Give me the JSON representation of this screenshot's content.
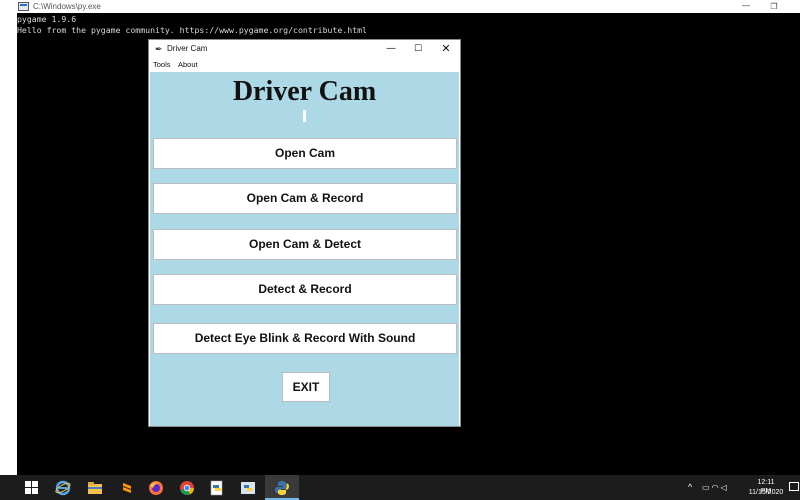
{
  "console": {
    "title": "C:\\Windows\\py.exe",
    "lines": [
      "pygame 1.9.6",
      "Hello from the pygame community. https://www.pygame.org/contribute.html"
    ],
    "controls": {
      "minimize": "—",
      "restore": "❐",
      "close": "✕"
    }
  },
  "app": {
    "title": "Driver Cam",
    "controls": {
      "minimize": "—",
      "maximize": "☐",
      "close": "✕"
    },
    "menu": [
      "Tools",
      "About"
    ],
    "heading": "Driver Cam",
    "buttons": [
      "Open Cam",
      "Open Cam & Record",
      "Open Cam & Detect",
      "Detect & Record",
      "Detect Eye Blink & Record With Sound"
    ],
    "exit_label": "EXIT",
    "background_color": "#add8e6"
  },
  "taskbar": {
    "pinned_icons": [
      "start-icon",
      "internet-explorer-icon",
      "file-explorer-icon",
      "sublime-text-icon",
      "firefox-icon",
      "chrome-icon",
      "python-idle-icon",
      "python-shell-icon",
      "python-app-icon"
    ],
    "tray_icons": [
      "chevron-up-icon",
      "battery-icon",
      "wifi-icon",
      "volume-icon"
    ],
    "clock_time": "12:11 PM",
    "clock_date": "11/15/2020"
  }
}
